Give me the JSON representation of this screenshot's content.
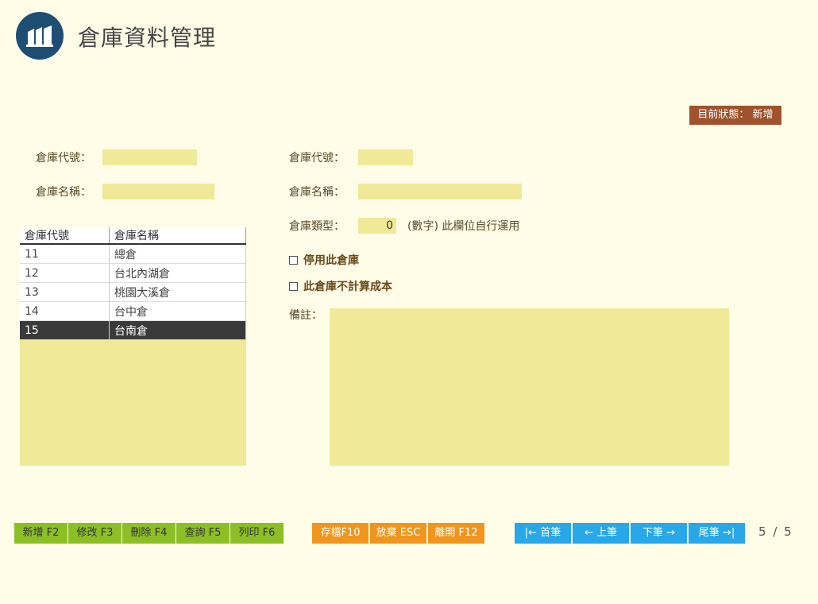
{
  "title": "倉庫資料管理",
  "status": "目前狀態： 新增",
  "search": {
    "code_label": "倉庫代號：",
    "name_label": "倉庫名稱："
  },
  "grid": {
    "headers": [
      "倉庫代號",
      "倉庫名稱"
    ],
    "rows": [
      {
        "code": "11",
        "name": "總倉"
      },
      {
        "code": "12",
        "name": "台北內湖倉"
      },
      {
        "code": "13",
        "name": "桃園大溪倉"
      },
      {
        "code": "14",
        "name": "台中倉"
      },
      {
        "code": "15",
        "name": "台南倉"
      }
    ],
    "selected_index": 4
  },
  "form": {
    "code_label": "倉庫代號：",
    "name_label": "倉庫名稱：",
    "type_label": "倉庫類型：",
    "type_value": "0",
    "type_hint": "(數字) 此欄位自行運用",
    "disable_label": "停用此倉庫",
    "nocost_label": "此倉庫不計算成本",
    "memo_label": "備註："
  },
  "buttons": {
    "add": "新增 F2",
    "edit": "修改 F3",
    "delete": "刪除 F4",
    "query": "查詢 F5",
    "print": "列印 F6",
    "save": "存檔F10",
    "cancel": "放棄 ESC",
    "exit": "離開 F12",
    "first": "|← 首筆",
    "prev": "← 上筆",
    "next": "下筆 →",
    "last": "尾筆 →|"
  },
  "pager": {
    "current": "5",
    "sep": "/",
    "total": "5"
  },
  "colors": {
    "background": "#fffde8",
    "field": "#f0e998",
    "status": "#a0522d",
    "green": "#8cbf26",
    "orange": "#f0961e",
    "blue": "#28a8e8",
    "logo": "#1f4e73"
  }
}
